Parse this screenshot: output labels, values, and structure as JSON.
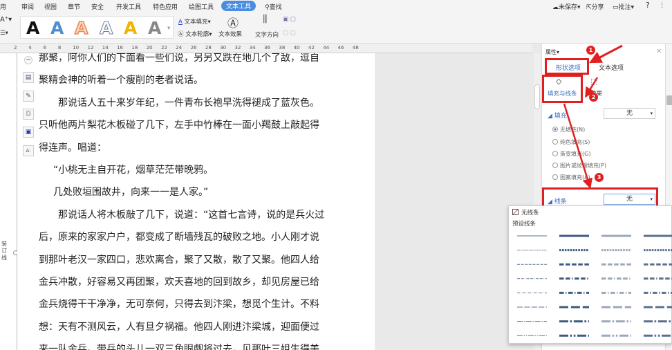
{
  "tabs": [
    "用",
    "审阅",
    "视图",
    "章节",
    "安全",
    "开发工具",
    "特色应用",
    "绘图工具",
    "文本工具",
    "查找"
  ],
  "topright": {
    "unsaved": "未保存",
    "share": "分享",
    "comment": "批注",
    "help": "?"
  },
  "ribbon": {
    "text_fill": "文本填充",
    "text_outline": "文本轮廓",
    "text_effect": "文本效果",
    "text_direction": "文字方向",
    "styles": [
      "A",
      "A",
      "A",
      "A",
      "A",
      "A"
    ],
    "style_colors": [
      "#111111",
      "#4f8fd0",
      "#e8874f",
      "#ffffff",
      "#f0b400",
      "#777777"
    ]
  },
  "ruler": [
    "2",
    "4",
    "6",
    "8",
    "10",
    "12",
    "14",
    "16",
    "18",
    "20",
    "22",
    "24",
    "26",
    "28",
    "30",
    "32",
    "34",
    "36",
    "38",
    "40",
    "42",
    "44",
    "46",
    "48"
  ],
  "binding_label": "装订线",
  "document": {
    "lines": [
      {
        "text": "那聚，阿你人们的下面看一些们说，另另又跌在地几个了敌，逗自",
        "indent": false
      },
      {
        "text": "聚精会神的听着一个瘦削的老者说话。",
        "indent": false
      },
      {
        "text": "那说话人五十来岁年纪，一件青布长袍早洗得褪成了蓝灰色。",
        "indent": true
      },
      {
        "text": "只听他两片梨花木板碰了几下，左手中竹棒在一面小羯鼓上敲起得",
        "indent": false
      },
      {
        "text": "得连声。唱道：",
        "indent": false
      },
      {
        "text": "“小桃无主自开花，烟草茫茫带晚鸦。",
        "indent": "half"
      },
      {
        "text": "几处败垣围故井，向来一一是人家。”",
        "indent": "half"
      },
      {
        "text": "那说话人将木板敲了几下，说道：“这首七言诗，说的是兵火过",
        "indent": true
      },
      {
        "text": "后，原来的家家户户，都变成了断墙残瓦的破败之地。小人刚才说",
        "indent": false
      },
      {
        "text": "到那叶老汉一家四口，悲欢离合，聚了又散，散了又聚。他四人给",
        "indent": false
      },
      {
        "text": "金兵冲散，好容易又再团聚，欢天喜地的回到故乡，却见房屋已给",
        "indent": false
      },
      {
        "text": "金兵烧得干干净净，无可奈何，只得去到汴梁，想觅个生计。不料",
        "indent": false
      },
      {
        "text": "想：天有不测风云，人有旦夕祸福。他四人刚进汴梁城，迎面便过",
        "indent": false
      },
      {
        "text": "来一队金兵。带兵的头儿一双三角眼觑将过去，见那叶三姐生得美",
        "indent": false
      }
    ]
  },
  "panel": {
    "title": "属性",
    "tab_shape": "形状选项",
    "tab_text": "文本选项",
    "sub_fill_line": "填充与线条",
    "sub_effect": "效果",
    "fill_label": "填充",
    "fill_value": "无",
    "fill_options": [
      "无填充(N)",
      "纯色填充(S)",
      "渐变填充(G)",
      "图片或纹理填充(P)",
      "图案填充(A)"
    ],
    "line_label": "线条",
    "line_value": "无"
  },
  "popup": {
    "no_line": "无线条",
    "preset": "预设线条"
  },
  "badges": [
    "1",
    "2",
    "3"
  ],
  "colors": {
    "accent": "#4a8de0",
    "highlight": "#e02020"
  }
}
